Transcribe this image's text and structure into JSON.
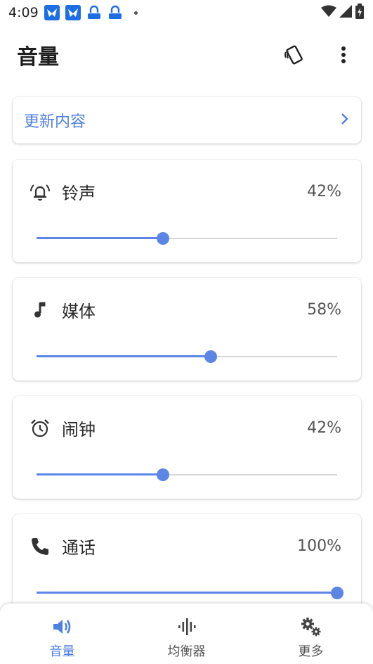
{
  "status_bar": {
    "time": "4:09"
  },
  "app_bar": {
    "title": "音量"
  },
  "update": {
    "label": "更新内容"
  },
  "volumes": [
    {
      "label": "铃声",
      "percent_text": "42%",
      "level": 0.42,
      "icon": "bell-icon"
    },
    {
      "label": "媒体",
      "percent_text": "58%",
      "level": 0.58,
      "icon": "music-note-icon"
    },
    {
      "label": "闹钟",
      "percent_text": "42%",
      "level": 0.42,
      "icon": "alarm-clock-icon"
    },
    {
      "label": "通话",
      "percent_text": "100%",
      "level": 1.0,
      "icon": "phone-icon"
    }
  ],
  "bottom_nav": {
    "items": [
      {
        "label": "音量",
        "icon": "speaker-icon",
        "active": true
      },
      {
        "label": "均衡器",
        "icon": "equalizer-icon",
        "active": false
      },
      {
        "label": "更多",
        "icon": "gears-icon",
        "active": false
      }
    ]
  },
  "colors": {
    "accent": "#5b86e5",
    "link": "#4f7fe0"
  }
}
